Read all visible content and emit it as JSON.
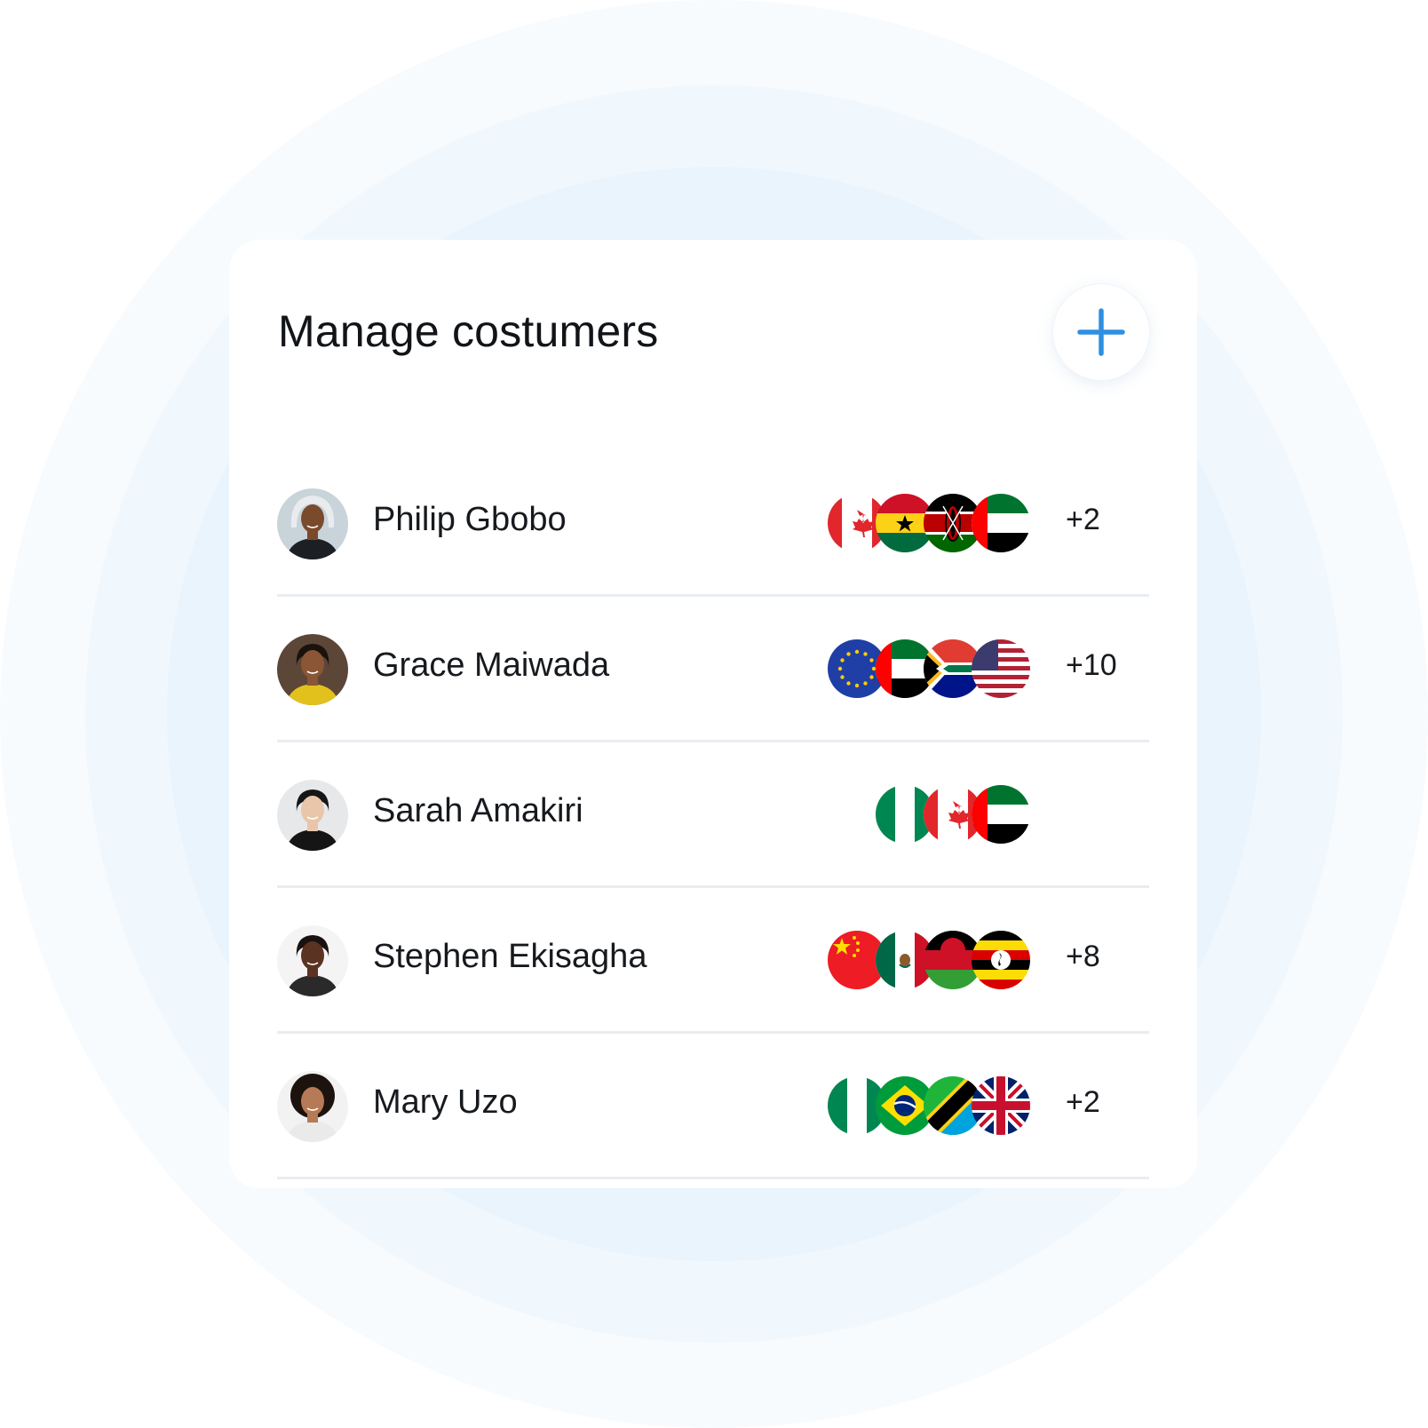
{
  "card": {
    "title": "Manage costumers",
    "add_button_icon": "plus-icon"
  },
  "colors": {
    "accent": "#2f8fe0",
    "divider": "#e9edf1",
    "text": "#16191d",
    "background_rings": [
      "#f7fbfe",
      "#f0f7fd",
      "#e9f4fd"
    ]
  },
  "customers": [
    {
      "name": "Philip Gbobo",
      "avatar": "avatar-photo",
      "flags": [
        "canada",
        "ghana",
        "kenya",
        "uae"
      ],
      "more": "+2"
    },
    {
      "name": "Grace Maiwada",
      "avatar": "avatar-photo",
      "flags": [
        "european-union",
        "uae",
        "south-africa",
        "united-states"
      ],
      "more": "+10"
    },
    {
      "name": "Sarah Amakiri",
      "avatar": "avatar-photo",
      "flags": [
        "nigeria",
        "canada",
        "uae"
      ],
      "more": ""
    },
    {
      "name": "Stephen Ekisagha",
      "avatar": "avatar-photo",
      "flags": [
        "china",
        "mexico",
        "malawi",
        "uganda"
      ],
      "more": "+8"
    },
    {
      "name": "Mary Uzo",
      "avatar": "avatar-photo",
      "flags": [
        "nigeria",
        "brazil",
        "tanzania",
        "united-kingdom"
      ],
      "more": "+2"
    }
  ]
}
